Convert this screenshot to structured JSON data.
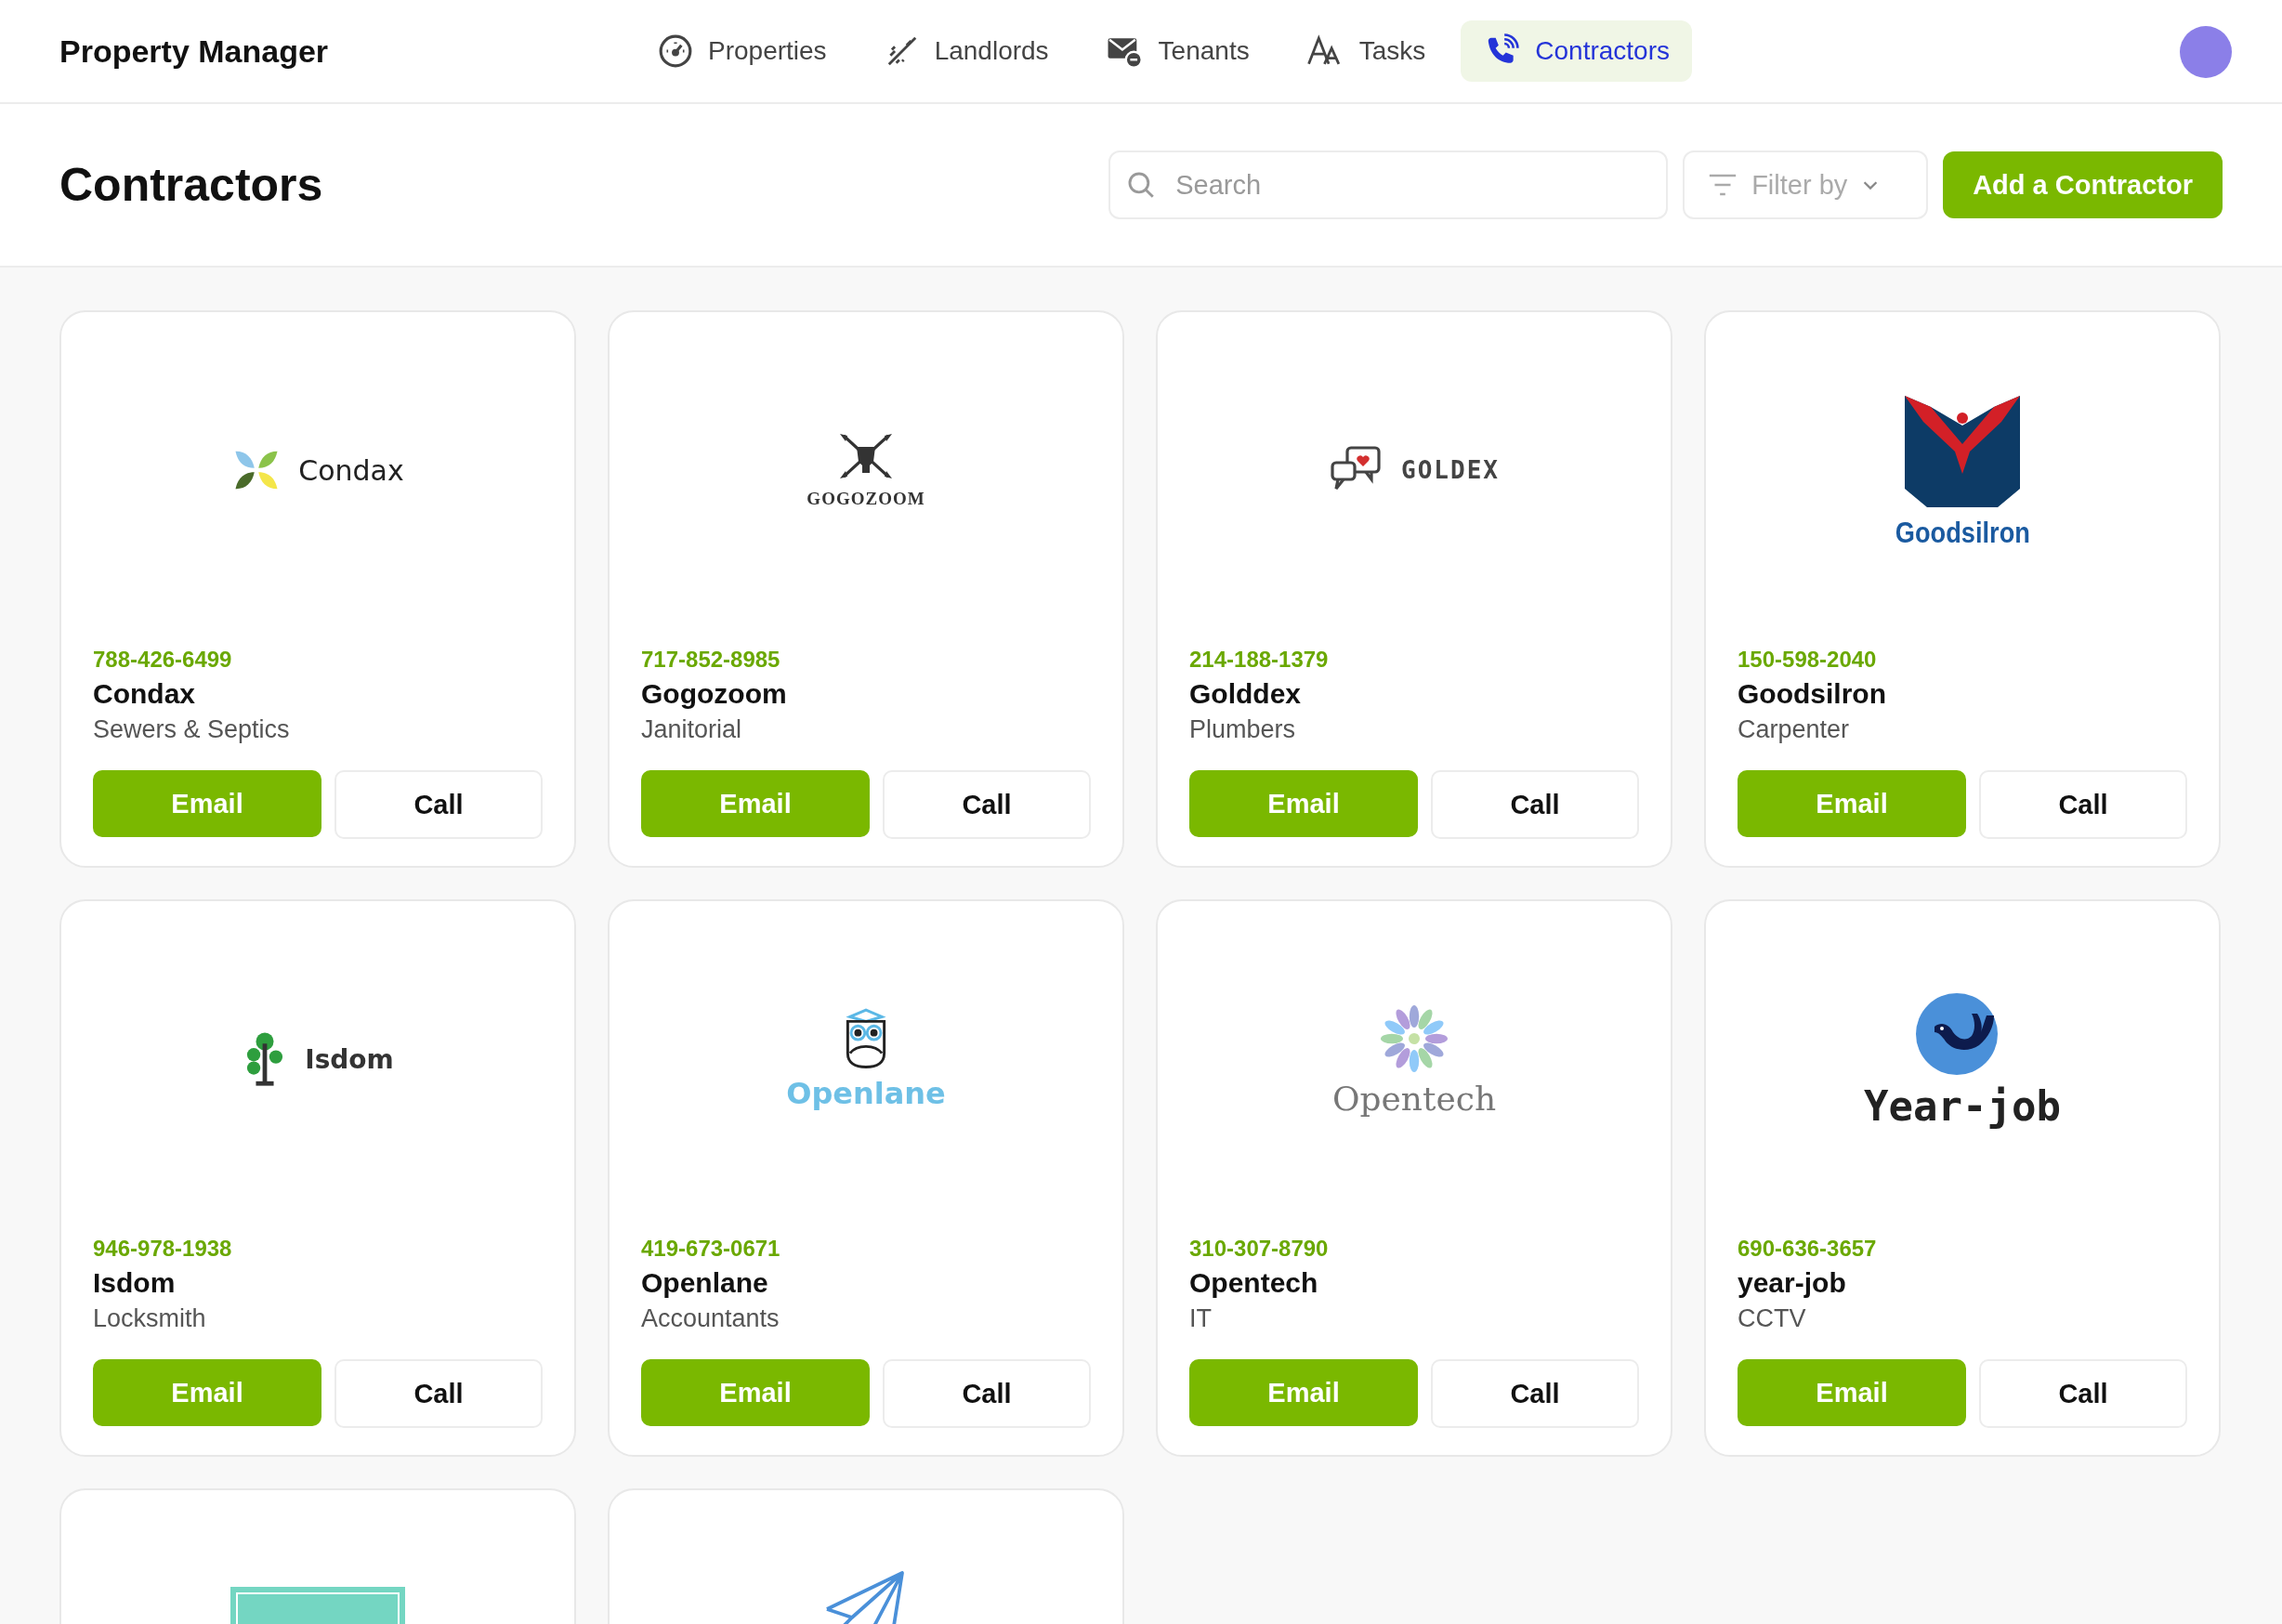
{
  "app": {
    "title": "Property Manager"
  },
  "nav": [
    {
      "label": "Properties",
      "kind": "gauge",
      "selected": false
    },
    {
      "label": "Landlords",
      "kind": "wand",
      "selected": false
    },
    {
      "label": "Tenants",
      "kind": "mail",
      "selected": false
    },
    {
      "label": "Tasks",
      "kind": "type",
      "selected": false
    },
    {
      "label": "Contractors",
      "kind": "phone",
      "selected": true
    }
  ],
  "page": {
    "title": "Contractors",
    "search": {
      "placeholder": "Search"
    },
    "filter": {
      "label": "Filter by"
    },
    "add_button": "Add a Contractor"
  },
  "contractors": [
    {
      "logo": {
        "kind": "condax",
        "text": "Condax"
      },
      "phone": "788-426-6499",
      "name": "Condax",
      "category": "Sewers & Septics",
      "email": "Email",
      "call": "Call"
    },
    {
      "logo": {
        "kind": "gogozoom",
        "text": "GOGOZOOM"
      },
      "phone": "717-852-8985",
      "name": "Gogozoom",
      "category": "Janitorial",
      "email": "Email",
      "call": "Call"
    },
    {
      "logo": {
        "kind": "goldex",
        "text": "GOLDEX"
      },
      "phone": "214-188-1379",
      "name": "Golddex",
      "category": "Plumbers",
      "email": "Email",
      "call": "Call"
    },
    {
      "logo": {
        "kind": "goodsilron",
        "text": "Goodsilron"
      },
      "phone": "150-598-2040",
      "name": "Goodsilron",
      "category": "Carpenter",
      "email": "Email",
      "call": "Call"
    },
    {
      "logo": {
        "kind": "isdom",
        "text": "Isdom"
      },
      "phone": "946-978-1938",
      "name": "Isdom",
      "category": "Locksmith",
      "email": "Email",
      "call": "Call"
    },
    {
      "logo": {
        "kind": "openlane",
        "text": "Openlane"
      },
      "phone": "419-673-0671",
      "name": "Openlane",
      "category": "Accountants",
      "email": "Email",
      "call": "Call"
    },
    {
      "logo": {
        "kind": "opentech",
        "text": "Opentech"
      },
      "phone": "310-307-8790",
      "name": "Opentech",
      "category": "IT",
      "email": "Email",
      "call": "Call"
    },
    {
      "logo": {
        "kind": "yearjob",
        "text": "Year-job"
      },
      "phone": "690-636-3657",
      "name": "year-job",
      "category": "CCTV",
      "email": "Email",
      "call": "Call"
    },
    {
      "logo": {
        "kind": "frame"
      }
    },
    {
      "logo": {
        "kind": "plane"
      }
    }
  ]
}
